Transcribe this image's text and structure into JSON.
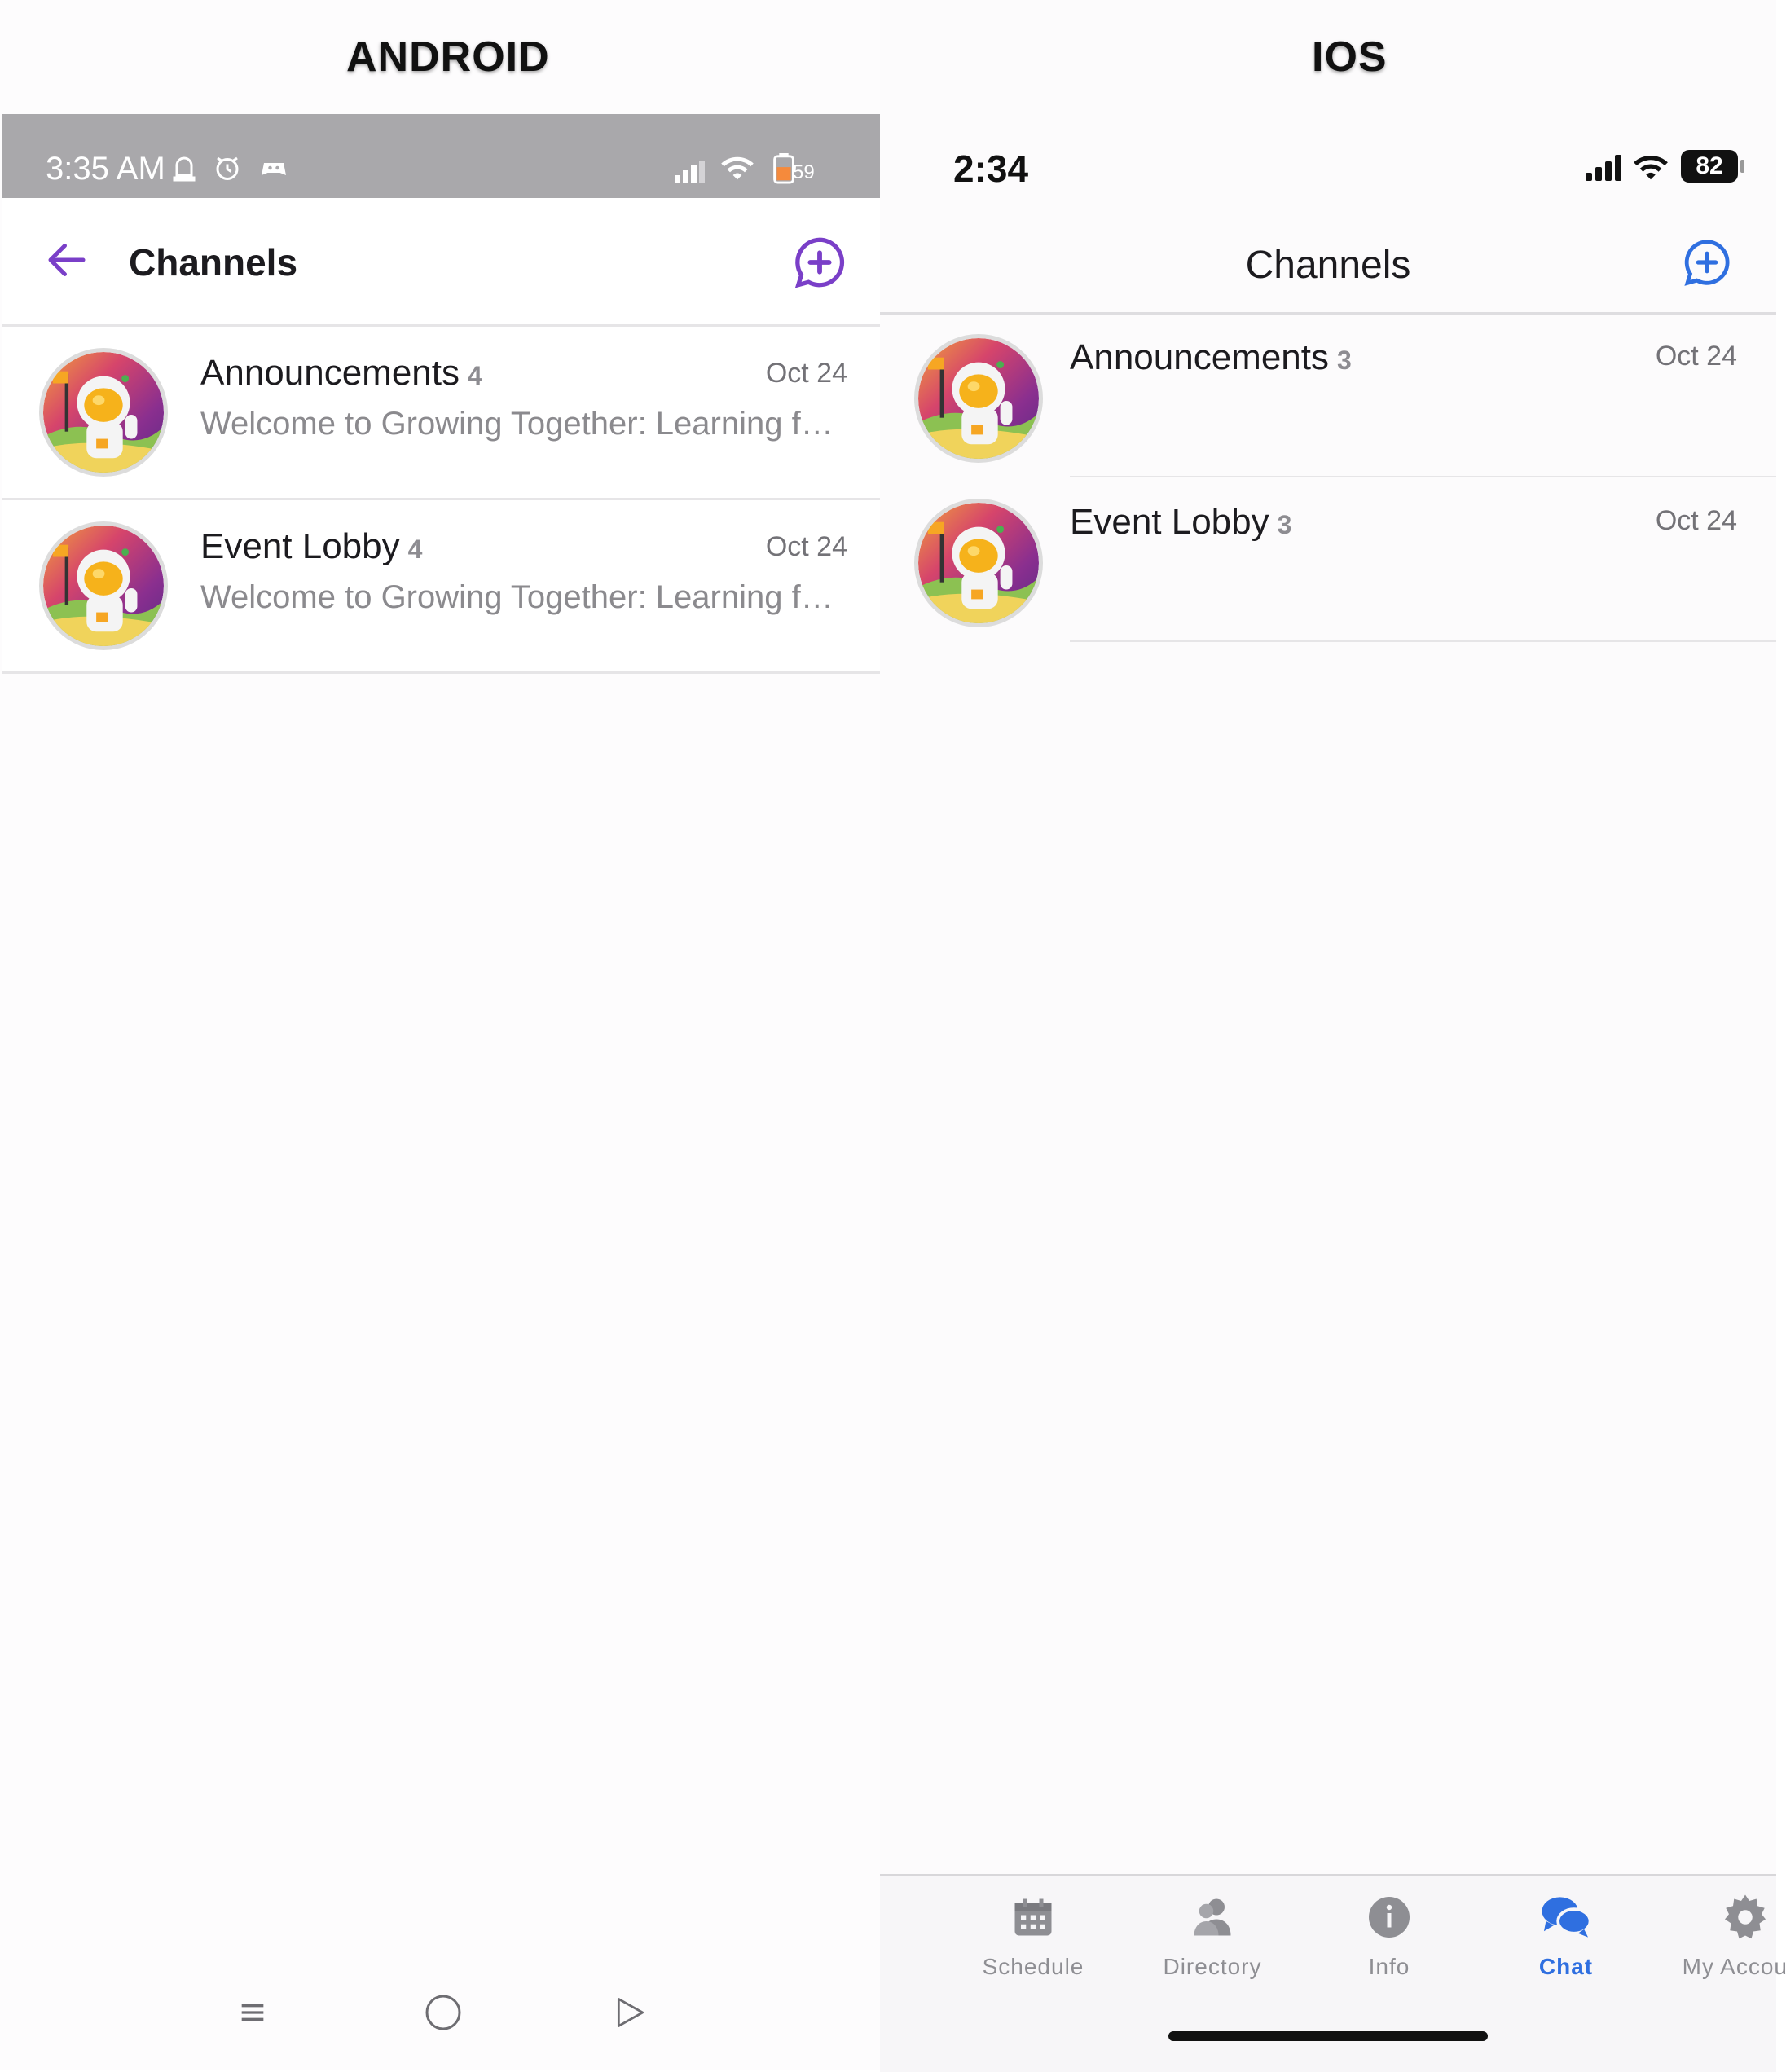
{
  "android": {
    "section_title": "ANDROID",
    "status": {
      "time": "3:35 AM",
      "battery": "59"
    },
    "header": {
      "title": "Channels"
    },
    "channels": [
      {
        "name": "Announcements",
        "count": "4",
        "date": "Oct 24",
        "preview": "Welcome to Growing Together: Learning fo..."
      },
      {
        "name": "Event Lobby",
        "count": "4",
        "date": "Oct 24",
        "preview": "Welcome to Growing Together: Learning fo..."
      }
    ]
  },
  "ios": {
    "section_title": "IOS",
    "status": {
      "time": "2:34",
      "battery": "82"
    },
    "header": {
      "title": "Channels"
    },
    "channels": [
      {
        "name": "Announcements",
        "count": "3",
        "date": "Oct 24"
      },
      {
        "name": "Event Lobby",
        "count": "3",
        "date": "Oct 24"
      }
    ],
    "tabs": [
      {
        "label": "Schedule",
        "icon": "calendar-icon"
      },
      {
        "label": "Directory",
        "icon": "people-icon"
      },
      {
        "label": "Info",
        "icon": "info-icon"
      },
      {
        "label": "Chat",
        "icon": "chat-icon",
        "active": true
      },
      {
        "label": "My Account",
        "icon": "gear-icon"
      }
    ]
  },
  "colors": {
    "android_accent": "#7a3fc8",
    "ios_accent": "#2f6fe0"
  }
}
